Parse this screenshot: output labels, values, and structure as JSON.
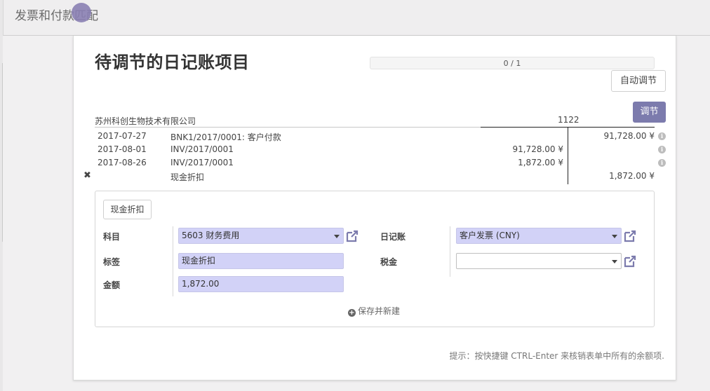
{
  "breadcrumb": "发票和付款匹配",
  "title": "待调节的日记账项目",
  "progress": {
    "text": "0 / 1",
    "fraction": 0.0
  },
  "buttons": {
    "auto_reconcile": "自动调节",
    "reconcile": "调节"
  },
  "partner": "苏州科创生物技术有限公司",
  "account_code": "1122",
  "lines": [
    {
      "date": "2017-07-27",
      "label": "BNK1/2017/0001: 客户付款",
      "debit": "",
      "credit": "91,728.00 ¥",
      "info": true,
      "removable": false
    },
    {
      "date": "2017-08-01",
      "label": "INV/2017/0001",
      "debit": "91,728.00 ¥",
      "credit": "",
      "info": true,
      "removable": false
    },
    {
      "date": "2017-08-26",
      "label": "INV/2017/0001",
      "debit": "1,872.00 ¥",
      "credit": "",
      "info": true,
      "removable": false
    },
    {
      "date": "",
      "label": "现金折扣",
      "debit": "",
      "credit": "1,872.00 ¥",
      "info": false,
      "removable": true
    }
  ],
  "form": {
    "preset_button": "现金折扣",
    "account_label": "科目",
    "account_value": "5603 财务费用",
    "journal_label": "日记账",
    "journal_value": "客户发票 (CNY)",
    "tag_label": "标签",
    "tag_value": "现金折扣",
    "tax_label": "税金",
    "tax_value": "",
    "amount_label": "金额",
    "amount_value": "1,872.00",
    "save_new": "保存并新建"
  },
  "hint": "提示：按快捷键 CTRL-Enter 来核销表单中所有的余额项.",
  "colors": {
    "accent": "#7c7bad",
    "input_bg": "#d2d2f7"
  },
  "icons": {
    "external_link": "external-link-icon",
    "info": "info-icon",
    "remove": "close-icon",
    "plus": "plus-circle-icon"
  }
}
